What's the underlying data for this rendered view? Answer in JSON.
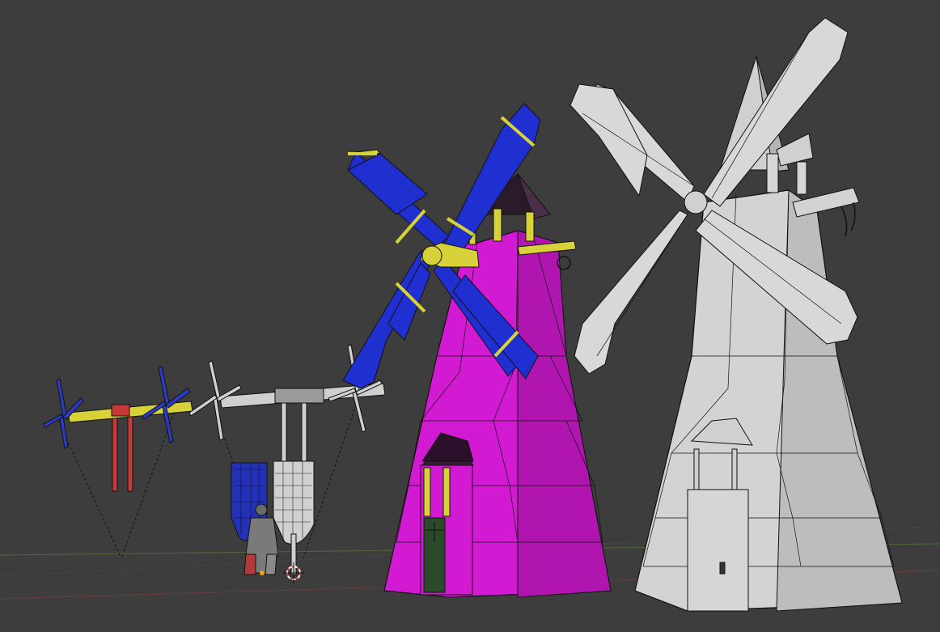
{
  "viewport": {
    "mode": "3D Viewport",
    "shading": "solid-wireframe-overlay",
    "background_color": "#3d3d3d"
  },
  "scene": {
    "objects": [
      {
        "id": "small-rotor-rig",
        "kind": "rotor-beam-with-props",
        "color": "#d8d23a",
        "prop_color": "#2d3cc8"
      },
      {
        "id": "gray-rotor-rig",
        "kind": "rotor-beam-with-banners",
        "color": "#cfcfcf"
      },
      {
        "id": "blue-banner",
        "kind": "banner",
        "color": "#2331b8"
      },
      {
        "id": "gray-banner",
        "kind": "banner",
        "color": "#cfcfcf"
      },
      {
        "id": "character",
        "kind": "figure-mesh",
        "color": "#8a8a8a"
      },
      {
        "id": "magenta-windmill",
        "kind": "windmill",
        "body_color": "#d21ad2",
        "sail_color": "#1f2fd0",
        "hub_color": "#d8d23a"
      },
      {
        "id": "gray-windmill",
        "kind": "windmill",
        "body_color": "#d3d3d3",
        "sail_color": "#d8d8d8"
      }
    ],
    "colors": {
      "grid_x_axis": "#8a3a3a",
      "grid_y_axis": "#5a7a3a",
      "wire": "#111111",
      "origin_cursor": "#e64040"
    }
  }
}
